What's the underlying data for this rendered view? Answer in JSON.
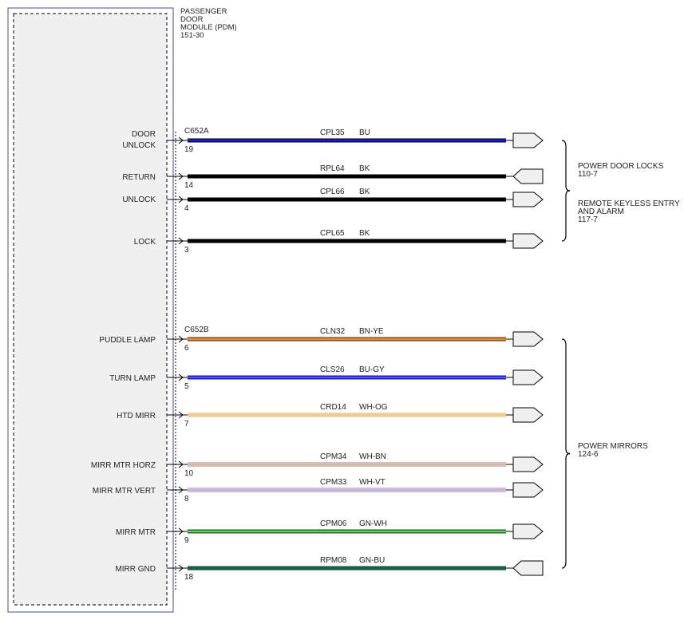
{
  "module": {
    "name_lines": [
      "PASSENGER",
      "DOOR",
      "MODULE (PDM)",
      "151-30"
    ]
  },
  "connectors": [
    {
      "id": "C652A"
    },
    {
      "id": "C652B"
    }
  ],
  "wires": [
    {
      "pin_label": [
        "DOOR",
        "UNLOCK"
      ],
      "pin": "19",
      "connector": "C652A",
      "circuit": "CPL35",
      "color_code": "BU",
      "stroke": "#1a1ad4",
      "stripe": "#1a1ad4",
      "outline": "#000000",
      "arrow": "right"
    },
    {
      "pin_label": [
        "RETURN"
      ],
      "pin": "14",
      "connector": "",
      "circuit": "RPL64",
      "color_code": "BK",
      "stroke": "#000000",
      "stripe": "#000000",
      "outline": "#000000",
      "arrow": "left"
    },
    {
      "pin_label": [
        "UNLOCK"
      ],
      "pin": "4",
      "connector": "",
      "circuit": "CPL66",
      "color_code": "BK",
      "stroke": "#000000",
      "stripe": "#000000",
      "outline": "#000000",
      "arrow": "right"
    },
    {
      "pin_label": [
        "LOCK"
      ],
      "pin": "3",
      "connector": "",
      "circuit": "CPL65",
      "color_code": "BK",
      "stroke": "#000000",
      "stripe": "#000000",
      "outline": "#000000",
      "arrow": "right"
    },
    {
      "pin_label": [
        "PUDDLE LAMP"
      ],
      "pin": "6",
      "connector": "C652B",
      "circuit": "CLN32",
      "color_code": "BN-YE",
      "stroke": "#b05a1e",
      "stripe": "#f2d34a",
      "outline": "#7a3a10",
      "arrow": "right"
    },
    {
      "pin_label": [
        "TURN LAMP"
      ],
      "pin": "5",
      "connector": "",
      "circuit": "CLS26",
      "color_code": "BU-GY",
      "stroke": "#1a1ad4",
      "stripe": "#9a9a9a",
      "outline": "#1a1ad4",
      "arrow": "right"
    },
    {
      "pin_label": [
        "HTD MIRR"
      ],
      "pin": "7",
      "connector": "",
      "circuit": "CRD14",
      "color_code": "WH-OG",
      "stroke": "#f5f0e6",
      "stripe": "#f0a030",
      "outline": "#e0b060",
      "arrow": "right"
    },
    {
      "pin_label": [
        "MIRR MTR HORZ"
      ],
      "pin": "10",
      "connector": "",
      "circuit": "CPM34",
      "color_code": "WH-BN",
      "stroke": "#ffffff",
      "stripe": "#b07050",
      "outline": "#b08070",
      "arrow": "right"
    },
    {
      "pin_label": [
        "MIRR MTR VERT"
      ],
      "pin": "8",
      "connector": "",
      "circuit": "CPM33",
      "color_code": "WH-VT",
      "stroke": "#ffffff",
      "stripe": "#9a6ab0",
      "outline": "#9a80b0",
      "arrow": "right"
    },
    {
      "pin_label": [
        "MIRR MTR"
      ],
      "pin": "9",
      "connector": "",
      "circuit": "CPM06",
      "color_code": "GN-WH",
      "stroke": "#1a8a1a",
      "stripe": "#e8f5e8",
      "outline": "#116611",
      "arrow": "right"
    },
    {
      "pin_label": [
        "MIRR GND"
      ],
      "pin": "18",
      "connector": "",
      "circuit": "RPM08",
      "color_code": "GN-BU",
      "stroke": "#1a7a3a",
      "stripe": "#1a3a8a",
      "outline": "#114422",
      "arrow": "left"
    }
  ],
  "destinations": [
    {
      "lines": [
        "POWER DOOR LOCKS",
        "110-7"
      ]
    },
    {
      "lines": [
        "REMOTE KEYLESS ENTRY",
        "AND ALARM",
        "117-7"
      ]
    },
    {
      "lines": [
        "POWER MIRRORS",
        "124-6"
      ]
    }
  ]
}
